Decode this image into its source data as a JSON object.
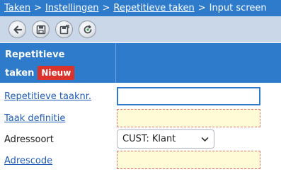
{
  "breadcrumb": {
    "items": [
      "Taken",
      "Instellingen",
      "Repetitieve taken"
    ],
    "separator": ">",
    "current": "Input screen"
  },
  "toolbar": {
    "buttons": [
      "back-icon",
      "save-icon",
      "save-close-icon",
      "refresh-icon"
    ]
  },
  "header": {
    "title_line1": "Repetitieve",
    "title_line2": "taken",
    "badge": "Nieuw"
  },
  "form": {
    "rows": [
      {
        "label": "Repetitieve taaknr.",
        "value": ""
      },
      {
        "label": "Taak definitie",
        "value": ""
      },
      {
        "label": "Adressoort",
        "value": "CUST: Klant"
      },
      {
        "label": "Adrescode",
        "value": ""
      }
    ]
  },
  "colors": {
    "brand_blue": "#2e7bcc",
    "toolbar_bg": "#c9d7e8",
    "badge_red": "#d9332b",
    "required_bg": "#fffbd6",
    "link": "#1f5cb8"
  }
}
